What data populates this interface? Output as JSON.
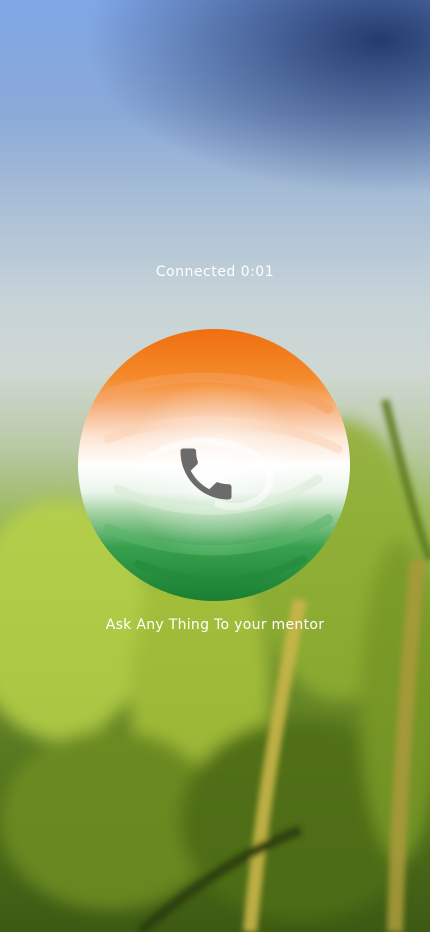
{
  "call": {
    "status": "Connected",
    "duration": "0:01",
    "caption": "Ask Any Thing To your mentor"
  },
  "icons": {
    "call_button": "phone-icon"
  },
  "colors": {
    "saffron": "#f07a1a",
    "white": "#ffffff",
    "green": "#1f8a3a",
    "icon_gray": "#6b6b6b",
    "text": "#ffffff"
  }
}
